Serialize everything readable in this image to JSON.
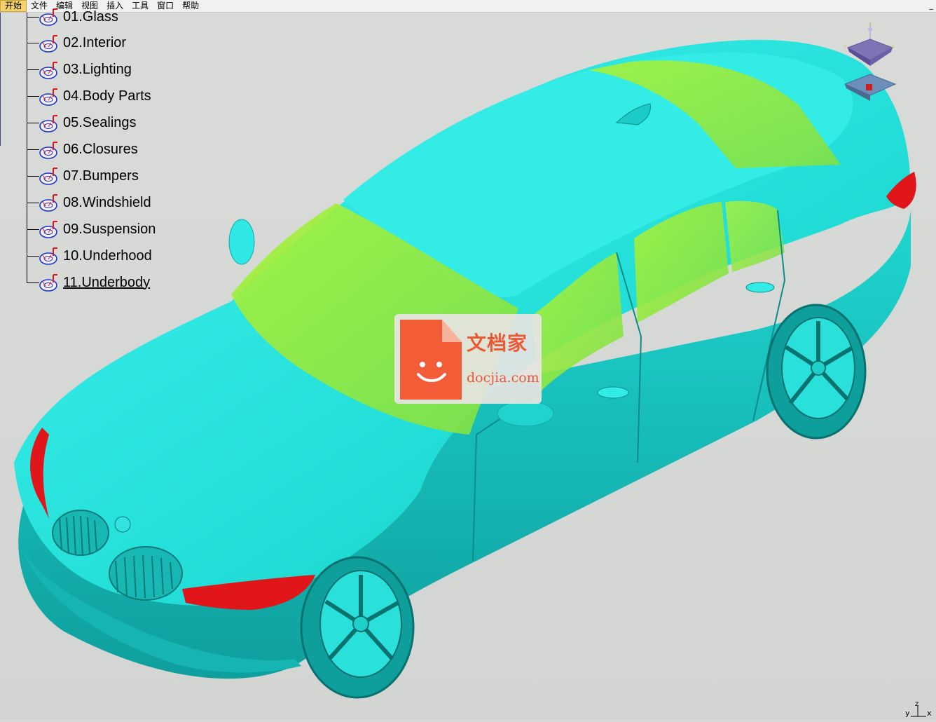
{
  "menu": {
    "items": [
      "开始",
      "文件",
      "编辑",
      "视图",
      "插入",
      "工具",
      "窗口",
      "帮助"
    ],
    "active_index": 0,
    "right_glyph": "_"
  },
  "tree": {
    "items": [
      {
        "label": "01.Glass"
      },
      {
        "label": "02.Interior"
      },
      {
        "label": "03.Lighting"
      },
      {
        "label": "04.Body Parts"
      },
      {
        "label": "05.Sealings"
      },
      {
        "label": "06.Closures"
      },
      {
        "label": "07.Bumpers"
      },
      {
        "label": "08.Windshield"
      },
      {
        "label": "09.Suspension"
      },
      {
        "label": "10.Underhood"
      },
      {
        "label": "11.Underbody"
      }
    ],
    "selected_index": 10
  },
  "compass": {
    "label_z": "z",
    "label_x": "x",
    "label_y": "y"
  },
  "axis_indicator": {
    "label_x": "x",
    "label_y": "y",
    "label_z": "z"
  },
  "watermark": {
    "cn": "文档家",
    "url": "docjia.com"
  },
  "colors": {
    "body": "#27e6e0",
    "glass": "#9cf03c",
    "lamps": "#e0161a",
    "background": "#d7d9d7",
    "tree_icon": "#1b38c8",
    "tree_icon_accent": "#e0161a",
    "watermark": "#ec5a33"
  }
}
